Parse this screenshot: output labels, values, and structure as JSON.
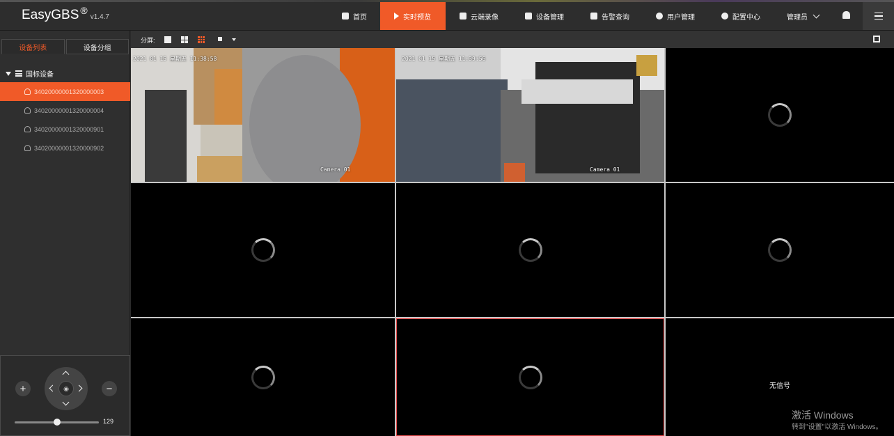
{
  "app": {
    "brand": "EasyGBS",
    "reg": "®",
    "version": "v1.4.7"
  },
  "nav": {
    "items": [
      {
        "label": "首页"
      },
      {
        "label": "实时预览"
      },
      {
        "label": "云端录像"
      },
      {
        "label": "设备管理"
      },
      {
        "label": "告警查询"
      },
      {
        "label": "用户管理"
      },
      {
        "label": "配置中心"
      }
    ],
    "active_index": 1,
    "user": "管理员"
  },
  "sidebar": {
    "tabs": [
      {
        "label": "设备列表"
      },
      {
        "label": "设备分组"
      }
    ],
    "tree_root": "国标设备",
    "devices": [
      {
        "id": "34020000001320000003"
      },
      {
        "id": "34020000001320000004"
      },
      {
        "id": "34020000001320000901"
      },
      {
        "id": "34020000001320000902"
      }
    ],
    "selected_index": 0
  },
  "ptz": {
    "speed": "129",
    "speed_fraction": 0.5
  },
  "toolbar": {
    "split_label": "分屏:"
  },
  "video": {
    "cells": [
      {
        "state": "playing",
        "osd_time": "2021 01 15 星期五 11:38:58",
        "osd_name": "Camera 01"
      },
      {
        "state": "playing",
        "osd_time": "2021 01 15 星期五 11:39:56",
        "osd_name": "Camera 01"
      },
      {
        "state": "loading"
      },
      {
        "state": "loading"
      },
      {
        "state": "loading"
      },
      {
        "state": "loading"
      },
      {
        "state": "loading"
      },
      {
        "state": "loading"
      },
      {
        "state": "no-signal",
        "text": "无信号"
      }
    ],
    "selected_index": 7
  },
  "watermark": {
    "line1": "激活 Windows",
    "line2": "转到\"设置\"以激活 Windows。"
  }
}
